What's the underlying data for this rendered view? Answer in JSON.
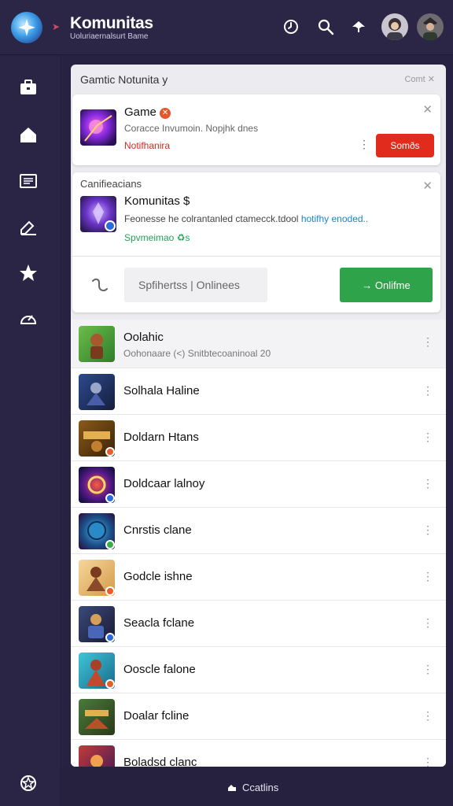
{
  "header": {
    "title": "Komunitas",
    "subtitle": "Uoluriaernalsurt Bame"
  },
  "panel": {
    "title": "Gamtic Notunita y",
    "close_label": "Comt ✕"
  },
  "notification_card": {
    "title": "Game",
    "subtitle": "Coracce Invumoin. Nopjhk dnes",
    "status": "Notifhanira",
    "button_label": "Somðs"
  },
  "community_card": {
    "header": "Canifieacians",
    "title": "Komunitas $",
    "description": "Feonesse he colrantanled ctamecck.tdool",
    "description_highlight": "hotifhy enoded..",
    "green_text": "Spvmeimao ♻s",
    "input_value": "Spfihertss | Onlinees",
    "button_label": "→ Onlifme"
  },
  "game_list": [
    {
      "name": "Oolahic",
      "subtitle": "Oohonaare (<) Snitbtecoaninoal 20"
    },
    {
      "name": "Solhala Haline"
    },
    {
      "name": "Doldarn Htans"
    },
    {
      "name": "Doldcaar lalnoy"
    },
    {
      "name": "Cnrstis clane"
    },
    {
      "name": "Godcle ishne"
    },
    {
      "name": "Seacla fclane"
    },
    {
      "name": "Ooscle falone"
    },
    {
      "name": "Doalar fcline"
    },
    {
      "name": "Boladsd clanc"
    }
  ],
  "bottom_bar": {
    "label": "Ccatlins"
  },
  "colors": {
    "header_bg": "#2b2646",
    "sidebar_bg": "#2a2545",
    "accent_red": "#e12b1c",
    "accent_green": "#2ea34a",
    "link_blue": "#1a86c8"
  }
}
